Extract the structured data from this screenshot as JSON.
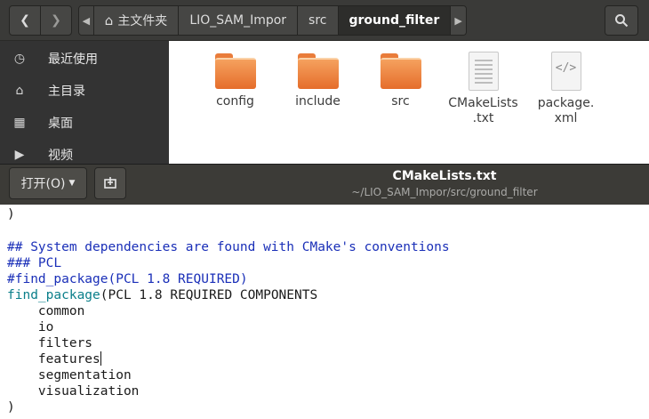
{
  "file_manager": {
    "breadcrumbs": [
      {
        "label": "主文件夹",
        "icon": "home-icon"
      },
      {
        "label": "LIO_SAM_Impor"
      },
      {
        "label": "src"
      },
      {
        "label": "ground_filter",
        "active": true
      }
    ],
    "sidebar": [
      {
        "label": "最近使用",
        "icon": "clock-icon"
      },
      {
        "label": "主目录",
        "icon": "home-icon"
      },
      {
        "label": "桌面",
        "icon": "folder-icon"
      },
      {
        "label": "视频",
        "icon": "video-icon"
      }
    ],
    "files": [
      {
        "label": "config",
        "type": "folder"
      },
      {
        "label": "include",
        "type": "folder"
      },
      {
        "label": "src",
        "type": "folder"
      },
      {
        "label": "CMakeLists\n.txt",
        "type": "text"
      },
      {
        "label": "package.\nxml",
        "type": "xml"
      }
    ]
  },
  "editor": {
    "open_label": "打开(O)",
    "title": "CMakeLists.txt",
    "path": "~/LIO_SAM_Impor/src/ground_filter",
    "lines": [
      {
        "text": ")",
        "style": "black"
      },
      {
        "text": "",
        "style": "black"
      },
      {
        "text": "## System dependencies are found with CMake's conventions",
        "style": "comment"
      },
      {
        "text": "### PCL",
        "style": "comment"
      },
      {
        "text": "#find_package(PCL 1.8 REQUIRED)",
        "style": "comment"
      },
      {
        "func": "find_package",
        "rest": "(PCL 1.8 REQUIRED COMPONENTS",
        "style": "func"
      },
      {
        "text": "    common",
        "style": "black"
      },
      {
        "text": "    io",
        "style": "black"
      },
      {
        "text": "    filters",
        "style": "black"
      },
      {
        "text": "    features",
        "style": "black",
        "cursor": true
      },
      {
        "text": "    segmentation",
        "style": "black"
      },
      {
        "text": "    visualization",
        "style": "black"
      },
      {
        "text": ")",
        "style": "black"
      }
    ]
  }
}
